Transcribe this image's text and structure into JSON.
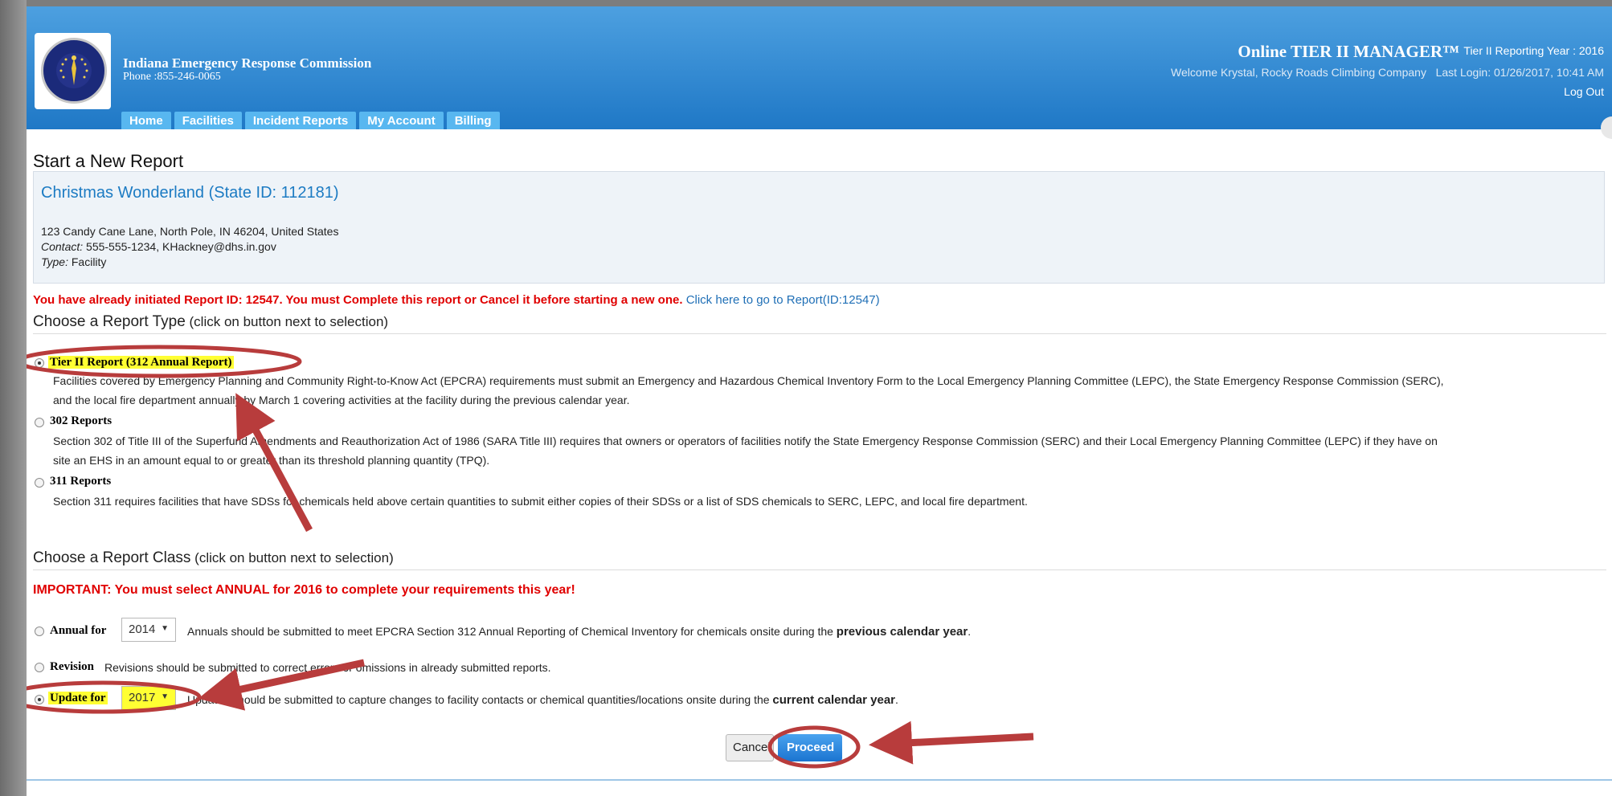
{
  "header": {
    "org_name": "Indiana Emergency Response Commission",
    "org_phone": "Phone :855-246-0065",
    "app_title": "Online TIER II MANAGER™",
    "reporting_year": "Tier II Reporting Year : 2016",
    "welcome": "Welcome Krystal, Rocky Roads Climbing Company   Last Login: 01/26/2017, 10:41 AM",
    "logout": "Log Out",
    "logo_text": "INDIANA EMERGENCY RESPONSE COMMISSION"
  },
  "nav": {
    "tabs": [
      "Home",
      "Facilities",
      "Incident Reports",
      "My Account",
      "Billing"
    ]
  },
  "page": {
    "title": "Start a New Report"
  },
  "facility": {
    "name": "Christmas Wonderland (State ID: 112181)",
    "address": "123 Candy Cane Lane, North Pole, IN 46204, United States",
    "contact_label": "Contact:",
    "contact_value": " 555-555-1234, KHackney@dhs.in.gov",
    "type_label": "Type:",
    "type_value": " Facility"
  },
  "warning": {
    "text": "You have already initiated Report ID: 12547. You must Complete this report or Cancel it before starting a new one.",
    "link": "Click here to go to Report(ID:12547)"
  },
  "report_type": {
    "heading": "Choose a Report Type",
    "hint": " (click on button next to selection)",
    "options": [
      {
        "label": "Tier II Report (312 Annual Report)",
        "selected": true,
        "desc1": "Facilities covered by Emergency Planning and Community Right-to-Know Act (EPCRA) requirements must submit an Emergency and Hazardous Chemical Inventory Form to the Local Emergency Planning Committee (LEPC), the State Emergency Response Commission (SERC),",
        "desc2": "and the local fire department annually by March 1 covering activities at the facility during the previous calendar year."
      },
      {
        "label": "302 Reports",
        "selected": false,
        "desc1": "Section 302 of Title III of the Superfund Amendments and Reauthorization Act of 1986 (SARA Title III) requires that owners or operators of facilities notify the State Emergency Response Commission (SERC) and their Local Emergency Planning Committee (LEPC) if they have on",
        "desc2": "site an EHS in an amount equal to or greater than its threshold planning quantity (TPQ)."
      },
      {
        "label": "311 Reports",
        "selected": false,
        "desc1": "Section 311 requires facilities that have SDSs for chemicals held above certain quantities to submit either copies of their SDSs or a list of SDS chemicals to SERC, LEPC, and local fire department.",
        "desc2": ""
      }
    ]
  },
  "report_class": {
    "heading": "Choose a Report Class",
    "hint": " (click on button next to selection)",
    "important": "IMPORTANT: You must select ANNUAL for 2016 to complete your requirements this year!",
    "annual": {
      "label": "Annual for",
      "year": "2014",
      "text_a": "Annuals should be submitted to meet EPCRA Section 312 Annual Reporting of Chemical Inventory for chemicals onsite during the ",
      "text_b": "previous calendar year",
      "text_c": "."
    },
    "revision": {
      "label": "Revision",
      "text": " Revisions should be submitted to correct errors or omissions in already submitted reports."
    },
    "update": {
      "label": "Update for",
      "year": "2017",
      "text_a": "Updates should be submitted to capture changes to facility contacts or chemical quantities/locations onsite during the ",
      "text_b": "current calendar year",
      "text_c": "."
    }
  },
  "buttons": {
    "cancel": "Cancel",
    "proceed": "Proceed"
  },
  "colors": {
    "header_top": "#4da0e0",
    "header_bottom": "#1f78c6",
    "tab": "#58b7f0",
    "warning_red": "#e00000",
    "link_blue": "#1f6fb6",
    "annotation_red": "#b83c3c",
    "highlight_yellow": "#ffff33"
  }
}
